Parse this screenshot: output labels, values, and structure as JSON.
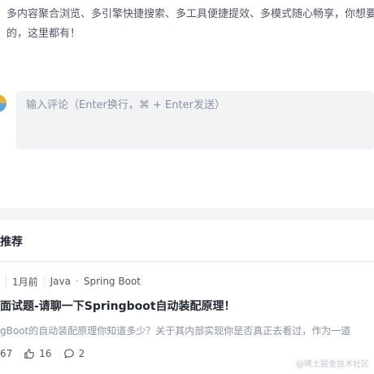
{
  "intro": {
    "line1": "多内容聚合浏览、多引擎快捷搜索、多工具便捷提效、多模式随心畅享，你想要",
    "line2": "的，这里都有！"
  },
  "comment": {
    "placeholder": "输入评论（Enter换行，⌘ + Enter发送）"
  },
  "recommend": {
    "title": "推荐"
  },
  "article": {
    "time": "1月前",
    "tag1": "Java",
    "tag2": "Spring Boot",
    "title": "面试题-请聊一下Springboot自动装配原理！",
    "abstract": "gBoot的自动装配原理你知道多少？关于其内部实现你是否真正去看过，作为一道",
    "views": "67",
    "likes": "16",
    "comments": "2"
  },
  "watermark": "@稀土掘金技术社区"
}
